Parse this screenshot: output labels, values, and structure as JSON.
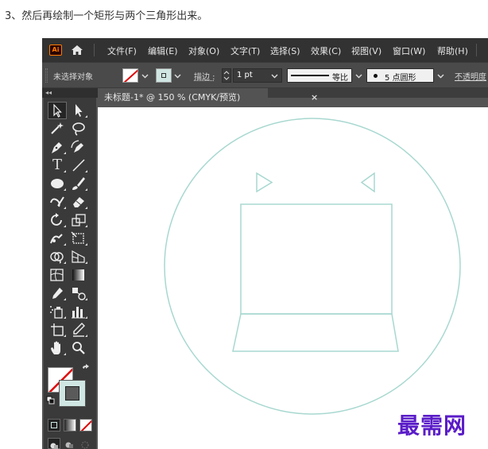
{
  "caption": "3、然后再绘制一个矩形与两个三角形出来。",
  "app": {
    "logo": "Ai",
    "home_icon": "home-icon",
    "menu": [
      "文件(F)",
      "编辑(E)",
      "对象(O)",
      "文字(T)",
      "选择(S)",
      "效果(C)",
      "视图(V)",
      "窗口(W)",
      "帮助(H)"
    ]
  },
  "control": {
    "no_selection": "未选择对象",
    "stroke_label": "描边 :",
    "stroke_weight": "1 pt",
    "profile_label": "等比",
    "brush_label": "5 点圆形",
    "opacity_label": "不透明度"
  },
  "toolbar": {
    "collapse": "◂◂",
    "tools": [
      "selection-tool",
      "direct-selection-tool",
      "magic-wand-tool",
      "lasso-tool",
      "pen-tool",
      "curvature-tool",
      "type-tool",
      "line-tool",
      "ellipse-tool",
      "paintbrush-tool",
      "shaper-tool",
      "eraser-tool",
      "rotate-tool",
      "scale-tool",
      "warp-tool",
      "free-transform-tool",
      "shape-builder-tool",
      "perspective-grid-tool",
      "mesh-tool",
      "gradient-tool",
      "eyedropper-tool",
      "blend-tool",
      "symbol-sprayer-tool",
      "column-graph-tool",
      "artboard-tool",
      "slice-tool",
      "hand-tool",
      "zoom-tool"
    ]
  },
  "document": {
    "tab_title": "未标题-1* @ 150 % (CMYK/预览)",
    "close": "×"
  },
  "colors": {
    "stroke_shape": "#a8d8d0",
    "fill_swatch": "#cfe6e2",
    "watermark": "#5a1cc8"
  },
  "watermark": "最需网"
}
